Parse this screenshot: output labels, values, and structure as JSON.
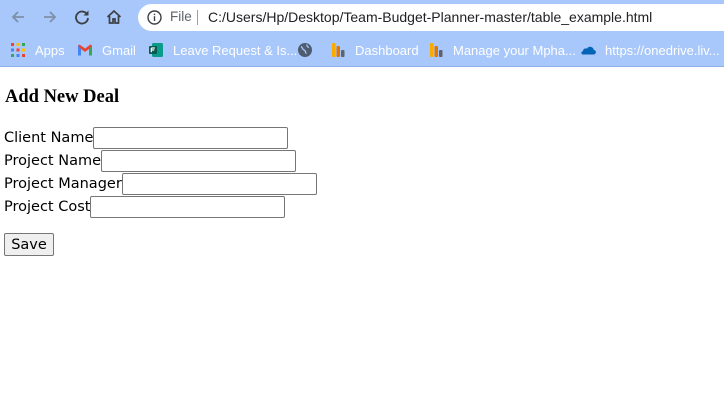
{
  "browser": {
    "address_bar": {
      "scheme_label": "File",
      "url": "C:/Users/Hp/Desktop/Team-Budget-Planner-master/table_example.html"
    },
    "nav_icons": [
      "back-arrow-icon",
      "forward-arrow-icon",
      "reload-icon",
      "home-icon",
      "info-icon"
    ],
    "bookmarks": [
      {
        "label": "Apps",
        "icon": "apps-grid-icon"
      },
      {
        "label": "Gmail",
        "icon": "gmail-icon"
      },
      {
        "label": "Leave Request & Is...",
        "icon": "forms-icon"
      },
      {
        "label": "",
        "icon": "globe-icon"
      },
      {
        "label": "Dashboard",
        "icon": "dashboard-bars-icon"
      },
      {
        "label": "Manage your Mpha...",
        "icon": "dashboard-bars-icon"
      },
      {
        "label": "https://onedrive.liv...",
        "icon": "onedrive-cloud-icon"
      }
    ],
    "colors": {
      "chrome": "#a8c7fa",
      "omnibox": "#ffffff"
    }
  },
  "form": {
    "heading": "Add New Deal",
    "fields": [
      {
        "label": "Client Name",
        "value": ""
      },
      {
        "label": "Project Name",
        "value": ""
      },
      {
        "label": "Project Manager",
        "value": ""
      },
      {
        "label": "Project Cost",
        "value": ""
      }
    ],
    "save_label": "Save"
  }
}
